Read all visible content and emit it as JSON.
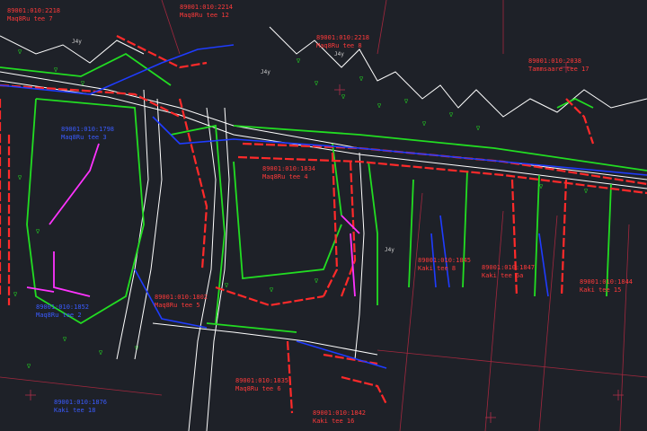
{
  "drawing": {
    "background_color": "#1e2128",
    "colors": {
      "building_outline": "#ff2a2a",
      "curb_line": "#22dd22",
      "water_line": "#1f3cff",
      "road_edge": "#ffffff",
      "parcel_line": "#b0304a",
      "highlight": "#ff33ff",
      "vegetation_symbol": "#22cc22"
    },
    "parcels": [
      {
        "id": "89001:010:2218",
        "address": "Maq8Ru tee 7",
        "color": "red"
      },
      {
        "id": "89001:010:2214",
        "address": "Maq8Ru tee 12",
        "color": "red"
      },
      {
        "id": "89001:010:2218",
        "address": "Maq8Ru tee 8",
        "color": "red"
      },
      {
        "id": "89001:010:2038",
        "address": "Tammsaare tee 17",
        "color": "red"
      },
      {
        "id": "89001:010:1798",
        "address": "Maq8Ru tee 3",
        "color": "blue"
      },
      {
        "id": "89001:010:1834",
        "address": "Maq8Ru tee 4",
        "color": "red"
      },
      {
        "id": "89001:010:1845",
        "address": "Kaki tee 8",
        "color": "red"
      },
      {
        "id": "89001:010:1847",
        "address": "Kaki tee 6a",
        "color": "red"
      },
      {
        "id": "89001:010:1844",
        "address": "Kaki tee 15",
        "color": "red"
      },
      {
        "id": "89001:010:1802",
        "address": "Maq8Ru tee 5",
        "color": "red"
      },
      {
        "id": "89001:010:1852",
        "address": "Maq8Ru tee 2",
        "color": "blue"
      },
      {
        "id": "89001:010:1835",
        "address": "Maq8Ru tee 6",
        "color": "red"
      },
      {
        "id": "89001:010:1842",
        "address": "Kaki tee 16",
        "color": "red"
      },
      {
        "id": "89001:010:1876",
        "address": "Kaki tee 18",
        "color": "blue"
      }
    ],
    "street_tags": [
      "J4y",
      "J4y",
      "J4y",
      "J4y"
    ]
  }
}
